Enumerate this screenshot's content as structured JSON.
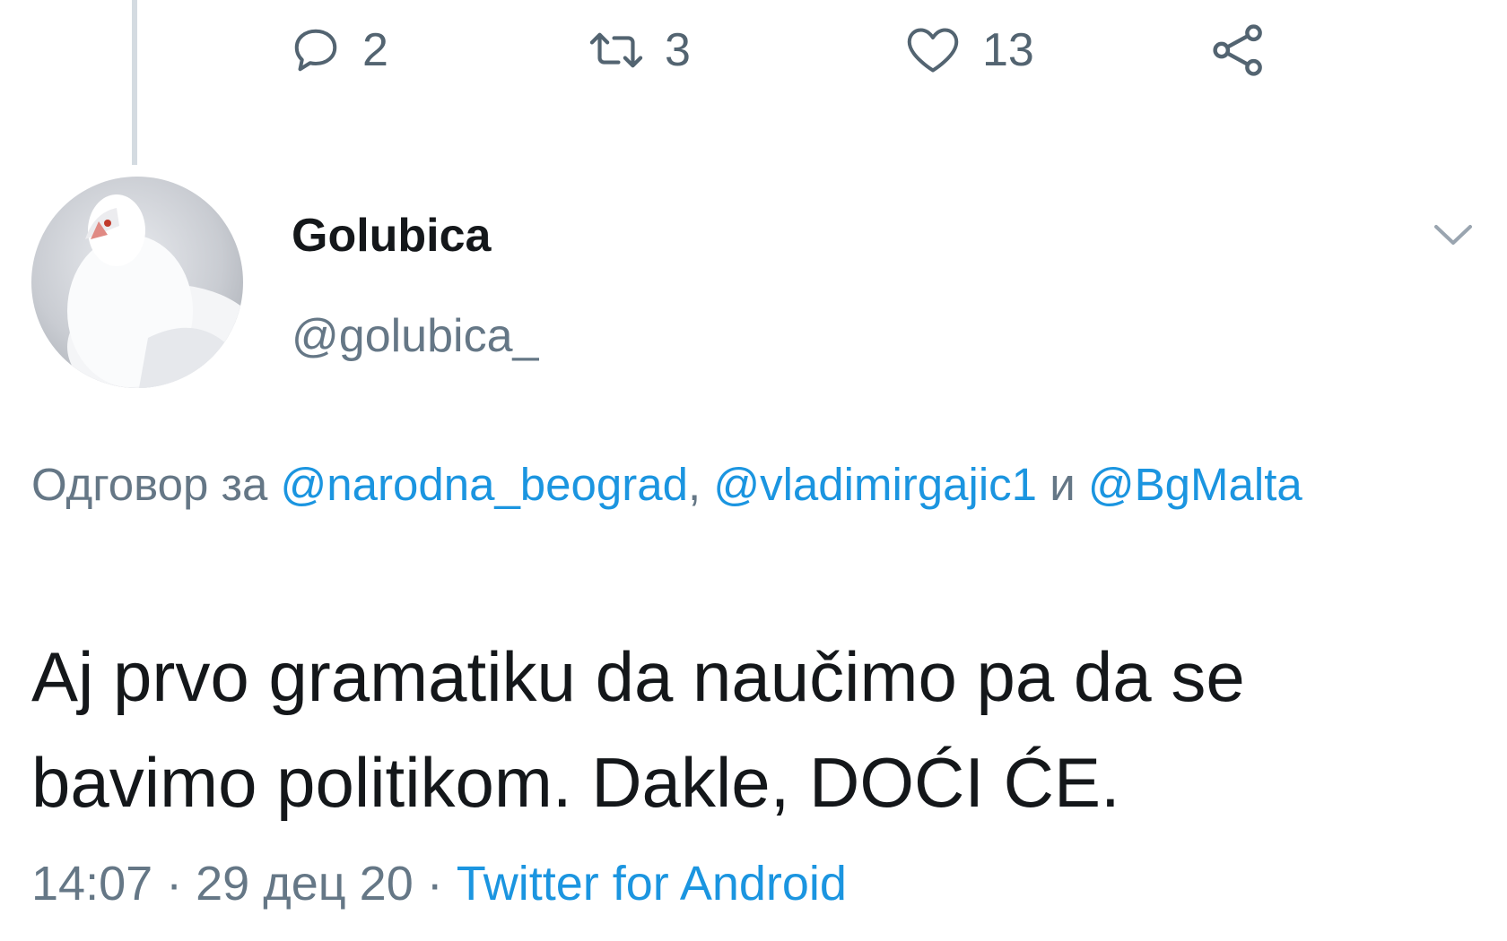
{
  "previous_tweet_actions": {
    "reply_icon": "reply-bubble-icon",
    "reply_count": "2",
    "retweet_icon": "retweet-icon",
    "retweet_count": "3",
    "like_icon": "heart-icon",
    "like_count": "13",
    "share_icon": "share-icon"
  },
  "tweet": {
    "avatar_icon": "white-dove-avatar",
    "display_name": "Golubica",
    "handle": "@golubica_",
    "menu_icon": "chevron-down-icon",
    "reply_prefix": "Одговор за ",
    "reply_mentions": [
      "@narodna_beograd",
      "@vladimirgajic1",
      "@BgMalta"
    ],
    "reply_separator": ", ",
    "reply_conjunction": " и ",
    "text": "Aj prvo gramatiku da naučimo pa da se bavimo politikom. Dakle, DOĆI ĆE.",
    "time": "14:07",
    "date": "29 дец 20",
    "dot": " · ",
    "source": "Twitter for Android"
  },
  "colors": {
    "link": "#1b95e0",
    "secondary_text": "#657786",
    "primary_text": "#14171a",
    "thread_line": "#d4dbe1"
  }
}
